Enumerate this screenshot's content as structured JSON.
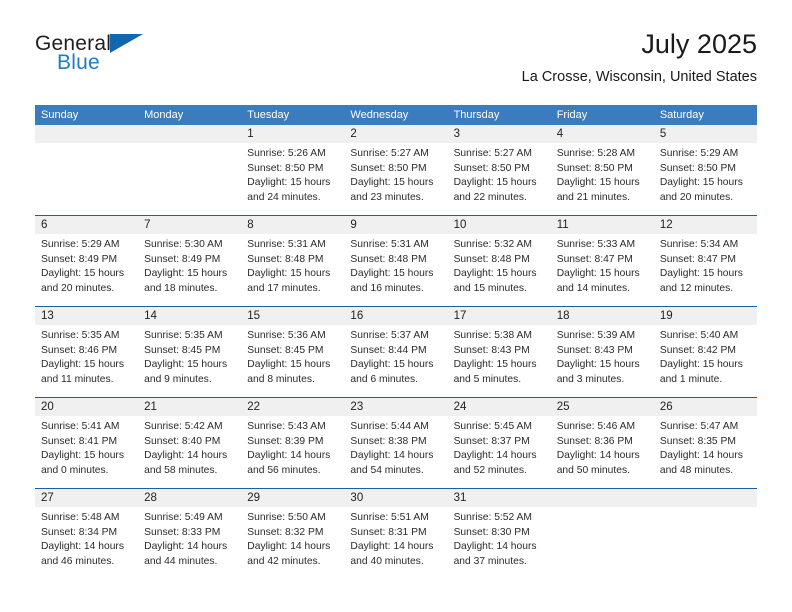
{
  "brand": {
    "name_top": "General",
    "name_bottom": "Blue",
    "triangle_color": "#1368ad",
    "blue_text_color": "#1a7fc1"
  },
  "header": {
    "title": "July 2025",
    "location": "La Crosse, Wisconsin, United States"
  },
  "theme": {
    "header_row_bg": "#3a7cbe",
    "week_divider": "#19619e",
    "daynum_band_bg": "#f0f0f0"
  },
  "weekdays": [
    "Sunday",
    "Monday",
    "Tuesday",
    "Wednesday",
    "Thursday",
    "Friday",
    "Saturday"
  ],
  "weeks": [
    {
      "days": [
        {
          "num": "",
          "lines": []
        },
        {
          "num": "",
          "lines": []
        },
        {
          "num": "1",
          "lines": [
            "Sunrise: 5:26 AM",
            "Sunset: 8:50 PM",
            "Daylight: 15 hours",
            "and 24 minutes."
          ]
        },
        {
          "num": "2",
          "lines": [
            "Sunrise: 5:27 AM",
            "Sunset: 8:50 PM",
            "Daylight: 15 hours",
            "and 23 minutes."
          ]
        },
        {
          "num": "3",
          "lines": [
            "Sunrise: 5:27 AM",
            "Sunset: 8:50 PM",
            "Daylight: 15 hours",
            "and 22 minutes."
          ]
        },
        {
          "num": "4",
          "lines": [
            "Sunrise: 5:28 AM",
            "Sunset: 8:50 PM",
            "Daylight: 15 hours",
            "and 21 minutes."
          ]
        },
        {
          "num": "5",
          "lines": [
            "Sunrise: 5:29 AM",
            "Sunset: 8:50 PM",
            "Daylight: 15 hours",
            "and 20 minutes."
          ]
        }
      ]
    },
    {
      "days": [
        {
          "num": "6",
          "lines": [
            "Sunrise: 5:29 AM",
            "Sunset: 8:49 PM",
            "Daylight: 15 hours",
            "and 20 minutes."
          ]
        },
        {
          "num": "7",
          "lines": [
            "Sunrise: 5:30 AM",
            "Sunset: 8:49 PM",
            "Daylight: 15 hours",
            "and 18 minutes."
          ]
        },
        {
          "num": "8",
          "lines": [
            "Sunrise: 5:31 AM",
            "Sunset: 8:48 PM",
            "Daylight: 15 hours",
            "and 17 minutes."
          ]
        },
        {
          "num": "9",
          "lines": [
            "Sunrise: 5:31 AM",
            "Sunset: 8:48 PM",
            "Daylight: 15 hours",
            "and 16 minutes."
          ]
        },
        {
          "num": "10",
          "lines": [
            "Sunrise: 5:32 AM",
            "Sunset: 8:48 PM",
            "Daylight: 15 hours",
            "and 15 minutes."
          ]
        },
        {
          "num": "11",
          "lines": [
            "Sunrise: 5:33 AM",
            "Sunset: 8:47 PM",
            "Daylight: 15 hours",
            "and 14 minutes."
          ]
        },
        {
          "num": "12",
          "lines": [
            "Sunrise: 5:34 AM",
            "Sunset: 8:47 PM",
            "Daylight: 15 hours",
            "and 12 minutes."
          ]
        }
      ]
    },
    {
      "days": [
        {
          "num": "13",
          "lines": [
            "Sunrise: 5:35 AM",
            "Sunset: 8:46 PM",
            "Daylight: 15 hours",
            "and 11 minutes."
          ]
        },
        {
          "num": "14",
          "lines": [
            "Sunrise: 5:35 AM",
            "Sunset: 8:45 PM",
            "Daylight: 15 hours",
            "and 9 minutes."
          ]
        },
        {
          "num": "15",
          "lines": [
            "Sunrise: 5:36 AM",
            "Sunset: 8:45 PM",
            "Daylight: 15 hours",
            "and 8 minutes."
          ]
        },
        {
          "num": "16",
          "lines": [
            "Sunrise: 5:37 AM",
            "Sunset: 8:44 PM",
            "Daylight: 15 hours",
            "and 6 minutes."
          ]
        },
        {
          "num": "17",
          "lines": [
            "Sunrise: 5:38 AM",
            "Sunset: 8:43 PM",
            "Daylight: 15 hours",
            "and 5 minutes."
          ]
        },
        {
          "num": "18",
          "lines": [
            "Sunrise: 5:39 AM",
            "Sunset: 8:43 PM",
            "Daylight: 15 hours",
            "and 3 minutes."
          ]
        },
        {
          "num": "19",
          "lines": [
            "Sunrise: 5:40 AM",
            "Sunset: 8:42 PM",
            "Daylight: 15 hours",
            "and 1 minute."
          ]
        }
      ]
    },
    {
      "days": [
        {
          "num": "20",
          "lines": [
            "Sunrise: 5:41 AM",
            "Sunset: 8:41 PM",
            "Daylight: 15 hours",
            "and 0 minutes."
          ]
        },
        {
          "num": "21",
          "lines": [
            "Sunrise: 5:42 AM",
            "Sunset: 8:40 PM",
            "Daylight: 14 hours",
            "and 58 minutes."
          ]
        },
        {
          "num": "22",
          "lines": [
            "Sunrise: 5:43 AM",
            "Sunset: 8:39 PM",
            "Daylight: 14 hours",
            "and 56 minutes."
          ]
        },
        {
          "num": "23",
          "lines": [
            "Sunrise: 5:44 AM",
            "Sunset: 8:38 PM",
            "Daylight: 14 hours",
            "and 54 minutes."
          ]
        },
        {
          "num": "24",
          "lines": [
            "Sunrise: 5:45 AM",
            "Sunset: 8:37 PM",
            "Daylight: 14 hours",
            "and 52 minutes."
          ]
        },
        {
          "num": "25",
          "lines": [
            "Sunrise: 5:46 AM",
            "Sunset: 8:36 PM",
            "Daylight: 14 hours",
            "and 50 minutes."
          ]
        },
        {
          "num": "26",
          "lines": [
            "Sunrise: 5:47 AM",
            "Sunset: 8:35 PM",
            "Daylight: 14 hours",
            "and 48 minutes."
          ]
        }
      ]
    },
    {
      "days": [
        {
          "num": "27",
          "lines": [
            "Sunrise: 5:48 AM",
            "Sunset: 8:34 PM",
            "Daylight: 14 hours",
            "and 46 minutes."
          ]
        },
        {
          "num": "28",
          "lines": [
            "Sunrise: 5:49 AM",
            "Sunset: 8:33 PM",
            "Daylight: 14 hours",
            "and 44 minutes."
          ]
        },
        {
          "num": "29",
          "lines": [
            "Sunrise: 5:50 AM",
            "Sunset: 8:32 PM",
            "Daylight: 14 hours",
            "and 42 minutes."
          ]
        },
        {
          "num": "30",
          "lines": [
            "Sunrise: 5:51 AM",
            "Sunset: 8:31 PM",
            "Daylight: 14 hours",
            "and 40 minutes."
          ]
        },
        {
          "num": "31",
          "lines": [
            "Sunrise: 5:52 AM",
            "Sunset: 8:30 PM",
            "Daylight: 14 hours",
            "and 37 minutes."
          ]
        },
        {
          "num": "",
          "lines": []
        },
        {
          "num": "",
          "lines": []
        }
      ]
    }
  ]
}
